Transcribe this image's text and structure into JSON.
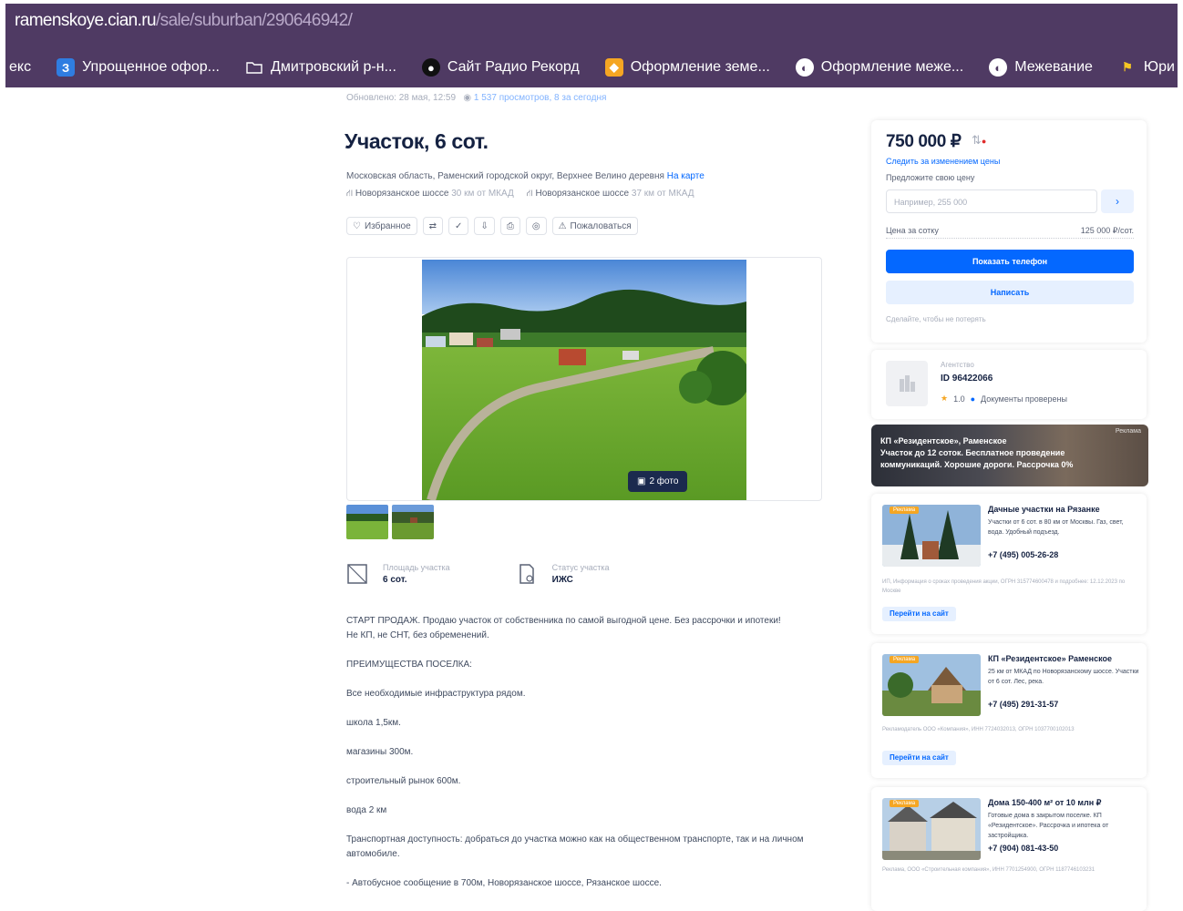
{
  "browser": {
    "url_host": "ramenskoye.cian.ru",
    "url_path": "/sale/suburban/290646942/",
    "bookmarks": [
      {
        "label": "екс",
        "icon": "none"
      },
      {
        "label": "Упрощенное офор...",
        "icon": "blue-doc-icon",
        "color": "#2f7de1"
      },
      {
        "label": "Дмитровский р-н...",
        "icon": "folder-icon"
      },
      {
        "label": "Сайт Радио Рекорд",
        "icon": "record-icon"
      },
      {
        "label": "Оформление земе...",
        "icon": "orange-icon",
        "color": "#f5a623"
      },
      {
        "label": "Оформление межe...",
        "icon": "globe-icon"
      },
      {
        "label": "Межевание",
        "icon": "globe-icon"
      },
      {
        "label": "Юри",
        "icon": "yellow-icon",
        "color": "#f5c623"
      }
    ]
  },
  "listing": {
    "meta": "Обновлено: 28 мая, 12:59",
    "views": "1 537 просмотров, 8 за сегодня",
    "title": "Участок, 6 сот.",
    "address": "Московская область, Раменский городской округ, Верхнее Велино деревня",
    "map_link": "На карте",
    "highways": [
      {
        "name": "Новорязанское шоссе",
        "dist": "30 км от МКАД"
      },
      {
        "name": "Новорязанское шоссе",
        "dist": "37 км от МКАД"
      }
    ],
    "toolbar": {
      "favorite": "Избранное",
      "complain": "Пожаловаться"
    },
    "photo_count": "2 фото",
    "facts": [
      {
        "label": "Площадь участка",
        "value": "6 сот."
      },
      {
        "label": "Статус участка",
        "value": "ИЖС"
      }
    ],
    "description": [
      "СТАРТ ПРОДАЖ. Продаю участок от собственника по самой выгодной цене. Без рассрочки и ипотеки!",
      "Не КП, не СНТ, без обременений.",
      "ПРЕИМУЩЕСТВА ПОСЕЛКА:",
      "Все необходимые инфраструктура рядом.",
      "школа 1,5км.",
      "магазины 300м.",
      "строительный рынок 600м.",
      "вода 2 км",
      "Транспортная доступность: добраться до участка можно как на общественном транспорте, так и на личном автомобиле.",
      "- Автобусное сообщение в 700м, Новорязанское шоссе, Рязанское шоссе."
    ]
  },
  "sidebar": {
    "price": "750 000 ₽",
    "price_link": "Следить за изменением цены",
    "offer_label": "Предложите свою цену",
    "offer_placeholder": "Например, 255 000",
    "ppa_label": "Цена за сотку",
    "ppa_value": "125 000 ₽/сот.",
    "phone_btn": "Показать телефон",
    "write_btn": "Написать",
    "note": "Сделайте, чтобы не потерять",
    "agent_role": "Агентство",
    "agent_id": "ID 96422066",
    "agent_rating": "1.0",
    "agent_docs": "Документы проверены",
    "promo_ad": "Реклама",
    "promo_title": "КП «Резидентское», Раменское",
    "promo_text": "Участок до 12 соток. Бесплатное проведение коммуникаций. Хорошие дороги. Рассрочка 0%",
    "ads": [
      {
        "title": "Дачные участки на Рязанке",
        "text": "Участки от 6 сот. в 80 км от Москвы. Газ, свет, вода. Удобный подъезд.",
        "phone": "+7 (495) 005-26-28",
        "legal": "ИП, Информация о сроках проведения акции, ОГРН 315774600478 и подробнее: 12.12.2023 по Москве",
        "btn": "Перейти на сайт"
      },
      {
        "title": "КП «Резидентское» Раменское",
        "text": "25 км от МКАД по Новорязанскому шоссе. Участки от 6 сот. Лес, река.",
        "phone": "+7 (495) 291-31-57",
        "legal": "Рекламодатель ООО «Компания», ИНН 7724032013, ОГРН 1037700102013",
        "btn": "Перейти на сайт"
      },
      {
        "title": "Дома 150-400 м² от 10 млн ₽",
        "text": "Готовые дома в закрытом поселке. КП «Резидентское». Рассрочка и ипотека от застройщика.",
        "phone": "+7 (904) 081-43-50",
        "legal": "Реклама, ООО «Строительная компания», ИНН 7701254900, ОГРН 1187746103231",
        "btn": "Перейти на сайт"
      }
    ]
  }
}
